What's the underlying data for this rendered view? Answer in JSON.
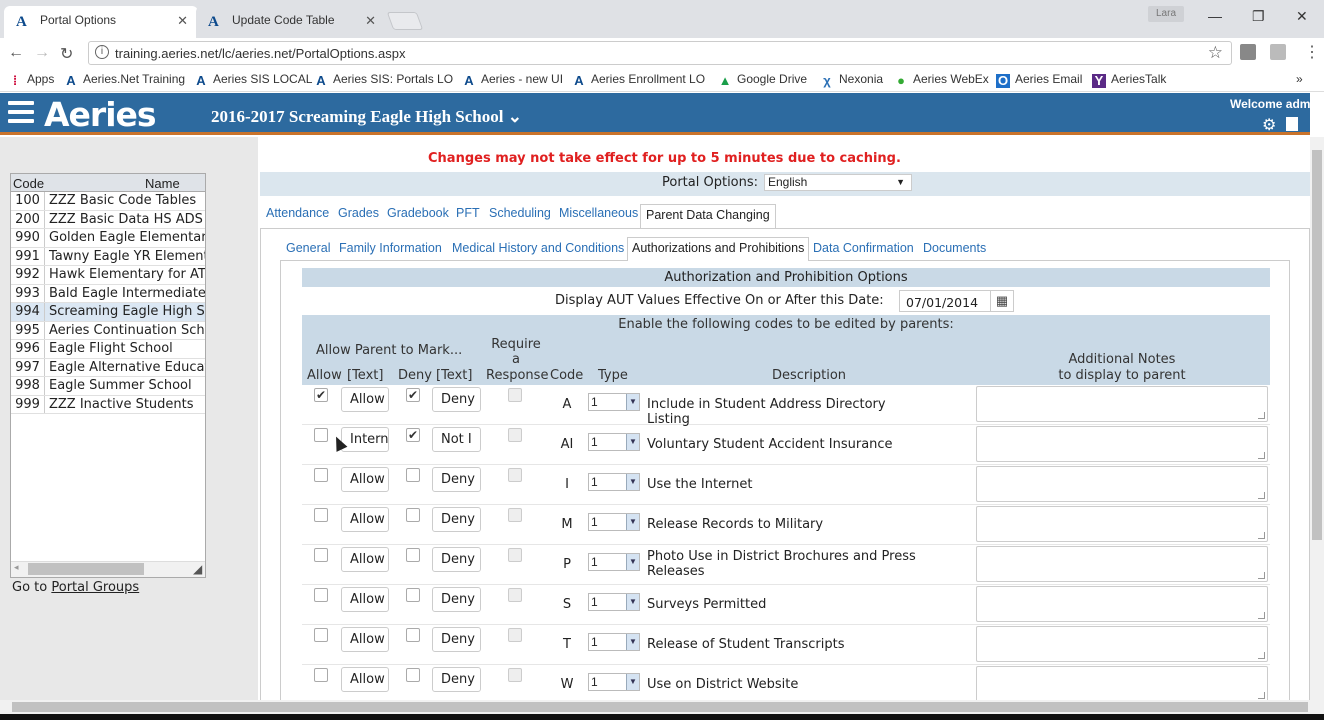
{
  "browser": {
    "tabs": [
      {
        "title": "Portal Options",
        "icon": "A"
      },
      {
        "title": "Update Code Table",
        "icon": "A"
      }
    ],
    "user": "Lara",
    "url": "training.aeries.net/lc/aeries.net/PortalOptions.aspx",
    "bookmarks": [
      {
        "label": "Apps",
        "icon": "apps-icon"
      },
      {
        "label": "Aeries.Net Training",
        "icon": "aeries-icon"
      },
      {
        "label": "Aeries SIS LOCAL",
        "icon": "aeries-icon"
      },
      {
        "label": "Aeries SIS: Portals LO",
        "icon": "aeries-icon"
      },
      {
        "label": "Aeries - new UI",
        "icon": "aeries-icon"
      },
      {
        "label": "Aeries Enrollment LO",
        "icon": "aeries-icon"
      },
      {
        "label": "Google Drive",
        "icon": "drive-icon"
      },
      {
        "label": "Nexonia",
        "icon": "nexonia-icon"
      },
      {
        "label": "Aeries WebEx",
        "icon": "webex-icon"
      },
      {
        "label": "Aeries Email",
        "icon": "outlook-icon"
      },
      {
        "label": "AeriesTalk",
        "icon": "yammer-icon"
      }
    ],
    "more": "»"
  },
  "app": {
    "logo": "Aeries",
    "school": "2016-2017 Screaming Eagle High School",
    "welcome": "Welcome adm",
    "brand_color": "#2d6a9f",
    "accent_color": "#c9732b"
  },
  "codelist": {
    "col_code": "Code",
    "col_name": "Name",
    "rows": [
      {
        "code": "100",
        "name": "ZZZ Basic Code Tables"
      },
      {
        "code": "200",
        "name": "ZZZ Basic Data HS ADS"
      },
      {
        "code": "990",
        "name": "Golden Eagle Elementar"
      },
      {
        "code": "991",
        "name": "Tawny Eagle YR Element"
      },
      {
        "code": "992",
        "name": "Hawk Elementary for AT"
      },
      {
        "code": "993",
        "name": "Bald Eagle Intermediate"
      },
      {
        "code": "994",
        "name": "Screaming Eagle High S"
      },
      {
        "code": "995",
        "name": "Aeries Continuation Sch"
      },
      {
        "code": "996",
        "name": "Eagle Flight School"
      },
      {
        "code": "997",
        "name": "Eagle Alternative Educat"
      },
      {
        "code": "998",
        "name": "Eagle Summer School"
      },
      {
        "code": "999",
        "name": "ZZZ Inactive Students"
      }
    ],
    "goto_prefix": "Go to",
    "goto_link": "Portal Groups"
  },
  "content": {
    "cache_msg": "Changes may not take effect for up to 5 minutes due to caching.",
    "portal_options_label": "Portal Options:",
    "language": "English",
    "tabs": [
      "Attendance",
      "Grades",
      "Gradebook",
      "PFT",
      "Scheduling",
      "Miscellaneous",
      "Parent Data Changing"
    ],
    "subtabs": [
      "General",
      "Family Information",
      "Medical History and Conditions",
      "Authorizations and Prohibitions",
      "Data Confirmation",
      "Documents"
    ],
    "section_title": "Authorization and Prohibition Options",
    "display_aut_label": "Display AUT Values Effective On or After this Date:",
    "display_aut_date": "07/01/2014",
    "enable_label": "Enable the following codes to be edited by parents:",
    "allow_parent_label": "Allow Parent to Mark...",
    "require_label": [
      "Require",
      "a",
      "Response"
    ],
    "col_allow": "Allow",
    "col_allow_text": "[Text]",
    "col_deny": "Deny",
    "col_deny_text": "[Text]",
    "col_code": "Code",
    "col_type": "Type",
    "col_description": "Description",
    "col_notes": [
      "Additional Notes",
      "to display to parent"
    ],
    "rows": [
      {
        "allow": true,
        "allow_text": "Allow",
        "deny": true,
        "deny_text": "Deny",
        "code": "A",
        "type": "1",
        "description": "Include in Student Address Directory Listing"
      },
      {
        "allow": false,
        "allow_text": "Intern",
        "deny": true,
        "deny_text": "Not I",
        "code": "AI",
        "type": "1",
        "description": "Voluntary Student Accident Insurance"
      },
      {
        "allow": false,
        "allow_text": "Allow",
        "deny": false,
        "deny_text": "Deny",
        "code": "I",
        "type": "1",
        "description": "Use the Internet"
      },
      {
        "allow": false,
        "allow_text": "Allow",
        "deny": false,
        "deny_text": "Deny",
        "code": "M",
        "type": "1",
        "description": "Release Records to Military"
      },
      {
        "allow": false,
        "allow_text": "Allow",
        "deny": false,
        "deny_text": "Deny",
        "code": "P",
        "type": "1",
        "description": "Photo Use in District Brochures and Press Releases"
      },
      {
        "allow": false,
        "allow_text": "Allow",
        "deny": false,
        "deny_text": "Deny",
        "code": "S",
        "type": "1",
        "description": "Surveys Permitted"
      },
      {
        "allow": false,
        "allow_text": "Allow",
        "deny": false,
        "deny_text": "Deny",
        "code": "T",
        "type": "1",
        "description": "Release of Student Transcripts"
      },
      {
        "allow": false,
        "allow_text": "Allow",
        "deny": false,
        "deny_text": "Deny",
        "code": "W",
        "type": "1",
        "description": "Use on District Website"
      }
    ]
  }
}
